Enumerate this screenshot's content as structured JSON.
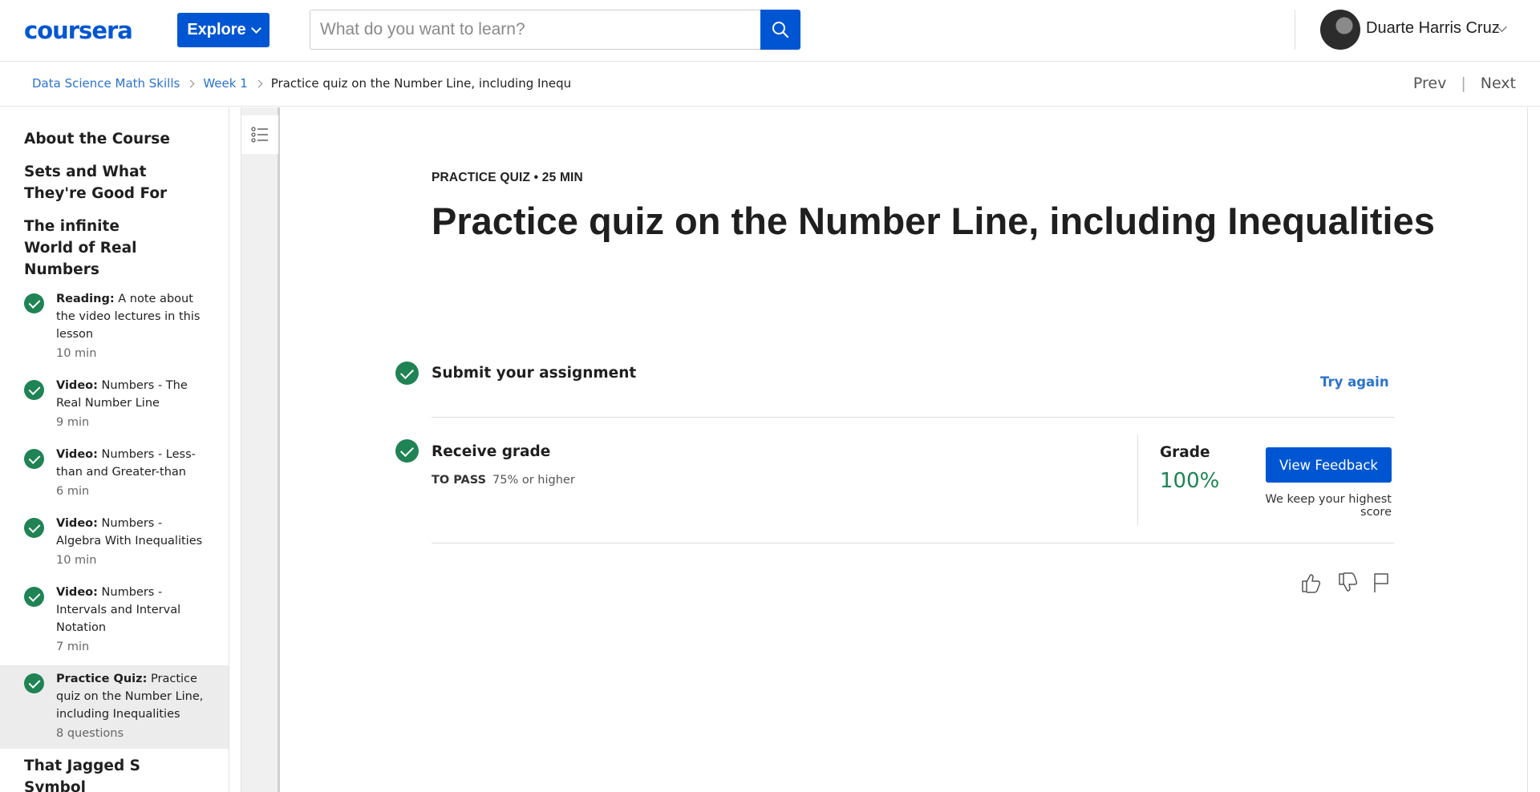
{
  "header": {
    "logo": "coursera",
    "explore_label": "Explore",
    "search_placeholder": "What do you want to learn?",
    "user_name": "Duarte Harris Cruz"
  },
  "breadcrumb": {
    "items": [
      "Data Science Math Skills",
      "Week 1"
    ],
    "current": "Practice quiz on the Number Line, including Inequaliti",
    "prev": "Prev",
    "next": "Next"
  },
  "sidebar": {
    "sections": [
      "About the Course",
      "Sets and What They're Good For",
      "The infinite World of Real Numbers",
      "That Jagged S Symbol"
    ],
    "items": [
      {
        "type": "Reading:",
        "label": "A note about the video lectures in this lesson",
        "duration": "10 min"
      },
      {
        "type": "Video:",
        "label": "Numbers - The Real Number Line",
        "duration": "9 min"
      },
      {
        "type": "Video:",
        "label": "Numbers - Less-than and Greater-than",
        "duration": "6 min"
      },
      {
        "type": "Video:",
        "label": "Numbers - Algebra With Inequalities",
        "duration": "10 min"
      },
      {
        "type": "Video:",
        "label": "Numbers - Intervals and Interval Notation",
        "duration": "7 min"
      },
      {
        "type": "Practice Quiz:",
        "label": "Practice quiz on the Number Line, including Inequalities",
        "duration": "8 questions"
      }
    ]
  },
  "main": {
    "meta": "PRACTICE QUIZ • 25 MIN",
    "title": "Practice quiz on the Number Line, including Inequalities",
    "submit_title": "Submit your assignment",
    "try_again": "Try again",
    "receive_title": "Receive grade",
    "to_pass_label": "TO PASS",
    "to_pass_value": "75% or higher",
    "grade_label": "Grade",
    "grade_value": "100%",
    "view_feedback": "View Feedback",
    "keep_note": "We keep your highest score"
  },
  "colors": {
    "brand": "#0056d2",
    "link": "#2a73cc",
    "success": "#1f8354"
  }
}
